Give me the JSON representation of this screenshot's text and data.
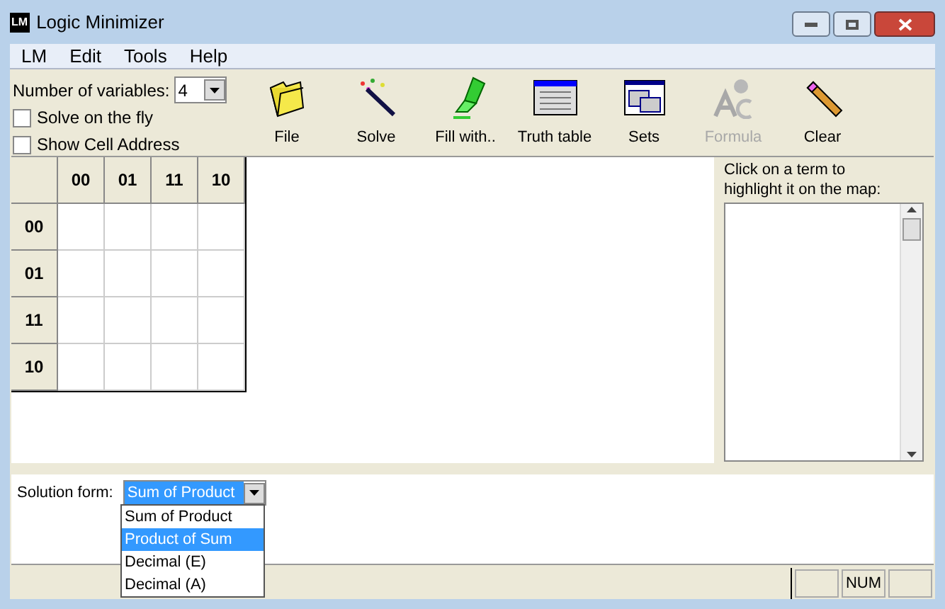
{
  "window": {
    "title": "Logic Minimizer",
    "app_icon": "LM"
  },
  "menu": [
    "LM",
    "Edit",
    "Tools",
    "Help"
  ],
  "variables": {
    "label": "Number of variables:",
    "value": "4"
  },
  "options": [
    {
      "label": "Solve on the fly",
      "checked": false
    },
    {
      "label": "Show Cell Address",
      "checked": false
    }
  ],
  "toolbar": [
    {
      "label": "File",
      "kind": "folder",
      "disabled": false
    },
    {
      "label": "Solve",
      "kind": "wand",
      "disabled": false
    },
    {
      "label": "Fill with..",
      "kind": "marker",
      "disabled": false
    },
    {
      "label": "Truth table",
      "kind": "table",
      "disabled": false
    },
    {
      "label": "Sets",
      "kind": "windows",
      "disabled": false
    },
    {
      "label": "Formula",
      "kind": "letters",
      "disabled": true
    },
    {
      "label": "Clear",
      "kind": "eraser",
      "disabled": false
    }
  ],
  "kmap": {
    "columns": [
      "00",
      "01",
      "11",
      "10"
    ],
    "rows": [
      "00",
      "01",
      "11",
      "10"
    ]
  },
  "terms": {
    "hint": "Click on a term to highlight it on the map:"
  },
  "solution_form": {
    "label": "Solution form:",
    "value": "Sum of Product",
    "options": [
      {
        "label": "Sum of Product",
        "highlighted": false
      },
      {
        "label": "Product of Sum",
        "highlighted": true
      },
      {
        "label": "Decimal (E)",
        "highlighted": false
      },
      {
        "label": "Decimal (A)",
        "highlighted": false
      }
    ]
  },
  "status_bar": {
    "indicator": "NUM"
  }
}
